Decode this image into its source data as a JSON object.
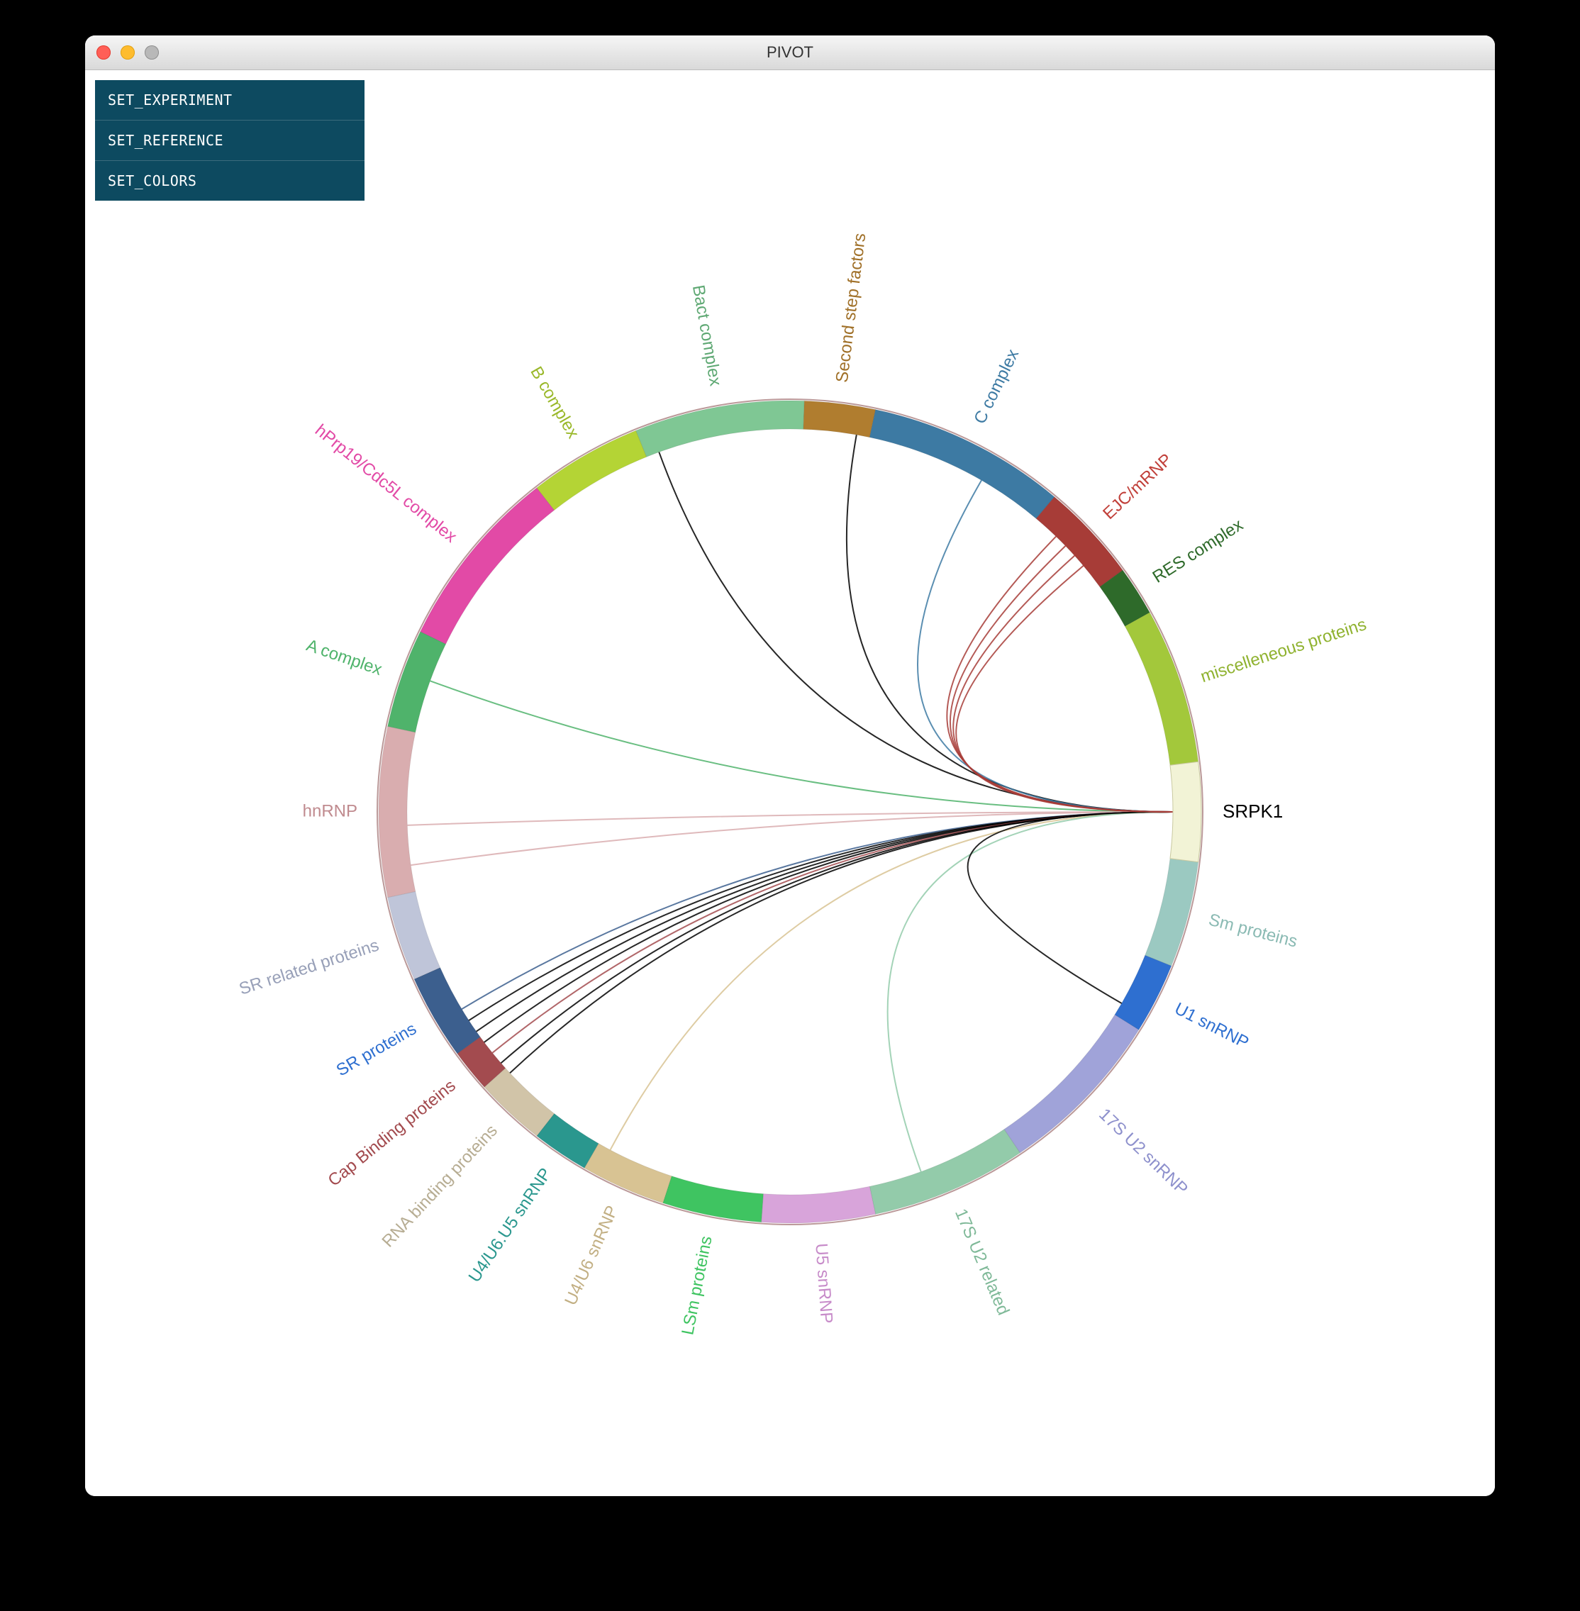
{
  "window": {
    "title": "PIVOT"
  },
  "menu": {
    "items": [
      {
        "label": "SET_EXPERIMENT"
      },
      {
        "label": "SET_REFERENCE"
      },
      {
        "label": "SET_COLORS"
      }
    ]
  },
  "chord": {
    "focus_label": "SRPK1",
    "focus_start_deg": -7,
    "focus_end_deg": 7,
    "focus_color": "#f2f3d6",
    "segments": [
      {
        "label": "Sm proteins",
        "start_deg": 7,
        "end_deg": 22,
        "color": "#9bc9c1",
        "label_color": "#8abab3"
      },
      {
        "label": "U1 snRNP",
        "start_deg": 22,
        "end_deg": 32,
        "color": "#2e6fd0",
        "label_color": "#2e6fd0"
      },
      {
        "label": "17S U2 snRNP",
        "start_deg": 32,
        "end_deg": 56,
        "color": "#a0a3d9",
        "label_color": "#8d90cc"
      },
      {
        "label": "17S U2 related",
        "start_deg": 56,
        "end_deg": 78,
        "color": "#93cbaa",
        "label_color": "#7fb998"
      },
      {
        "label": "U5 snRNP",
        "start_deg": 78,
        "end_deg": 94,
        "color": "#d8a4da",
        "label_color": "#c78bc9"
      },
      {
        "label": "LSm proteins",
        "start_deg": 94,
        "end_deg": 108,
        "color": "#3fc461",
        "label_color": "#3fc461"
      },
      {
        "label": "U4/U6 snRNP",
        "start_deg": 108,
        "end_deg": 120,
        "color": "#d8c393",
        "label_color": "#c2af83"
      },
      {
        "label": "U4/U6.U5 snRNP",
        "start_deg": 120,
        "end_deg": 128,
        "color": "#2a978e",
        "label_color": "#2a978e"
      },
      {
        "label": "RNA binding proteins",
        "start_deg": 128,
        "end_deg": 138,
        "color": "#d1c4a8",
        "label_color": "#b7ad93"
      },
      {
        "label": "Cap Binding proteins",
        "start_deg": 138,
        "end_deg": 144,
        "color": "#a34b4f",
        "label_color": "#a34b4f"
      },
      {
        "label": "SR proteins",
        "start_deg": 144,
        "end_deg": 156,
        "color": "#3c5f8e",
        "label_color": "#2e6fd0"
      },
      {
        "label": "SR related proteins",
        "start_deg": 156,
        "end_deg": 168,
        "color": "#bfc5d9",
        "label_color": "#98a0b8"
      },
      {
        "label": "hnRNP",
        "start_deg": 168,
        "end_deg": 192,
        "color": "#d9adaf",
        "label_color": "#c08b8f"
      },
      {
        "label": "A complex",
        "start_deg": 192,
        "end_deg": 206,
        "color": "#4fb36b",
        "label_color": "#4fb36b"
      },
      {
        "label": "hPrp19/Cdc5L complex",
        "start_deg": 206,
        "end_deg": 232,
        "color": "#e24aa6",
        "label_color": "#e24aa6"
      },
      {
        "label": "B complex",
        "start_deg": 232,
        "end_deg": 248,
        "color": "#b4d435",
        "label_color": "#9ab82a"
      },
      {
        "label": "Bact complex",
        "start_deg": 248,
        "end_deg": 272,
        "color": "#7fc794",
        "label_color": "#5ea873"
      },
      {
        "label": "Second step factors",
        "start_deg": 272,
        "end_deg": 282,
        "color": "#b07d2f",
        "label_color": "#a07028"
      },
      {
        "label": "C complex",
        "start_deg": 282,
        "end_deg": 310,
        "color": "#3d7aa3",
        "label_color": "#3d7aa3"
      },
      {
        "label": "EJC/mRNP",
        "start_deg": 310,
        "end_deg": 324,
        "color": "#a73c37",
        "label_color": "#c1403a"
      },
      {
        "label": "RES complex",
        "start_deg": 324,
        "end_deg": 331,
        "color": "#2e6a2a",
        "label_color": "#2e6a2a"
      },
      {
        "label": "miscelleneous proteins",
        "start_deg": 331,
        "end_deg": 353,
        "color": "#a3c83b",
        "label_color": "#8fb22f"
      }
    ],
    "links": [
      {
        "to_deg": 200,
        "color": "#4fb36b"
      },
      {
        "to_deg": 178,
        "color": "#d9adaf"
      },
      {
        "to_deg": 172,
        "color": "#d9adaf"
      },
      {
        "to_deg": 149,
        "color": "#3c5f8e"
      },
      {
        "to_deg": 147,
        "color": "#000000"
      },
      {
        "to_deg": 145,
        "color": "#000000"
      },
      {
        "to_deg": 143,
        "color": "#000000"
      },
      {
        "to_deg": 141,
        "color": "#a34b4f"
      },
      {
        "to_deg": 139,
        "color": "#000000"
      },
      {
        "to_deg": 137,
        "color": "#000000"
      },
      {
        "to_deg": 118,
        "color": "#d8c393"
      },
      {
        "to_deg": 70,
        "color": "#93cbaa"
      },
      {
        "to_deg": 30,
        "color": "#000000"
      },
      {
        "to_deg": 250,
        "color": "#000000"
      },
      {
        "to_deg": 280,
        "color": "#000000"
      },
      {
        "to_deg": 300,
        "color": "#3d7aa3"
      },
      {
        "to_deg": 314,
        "color": "#a73c37"
      },
      {
        "to_deg": 316,
        "color": "#a73c37"
      },
      {
        "to_deg": 318,
        "color": "#a73c37"
      },
      {
        "to_deg": 320,
        "color": "#a73c37"
      }
    ]
  }
}
